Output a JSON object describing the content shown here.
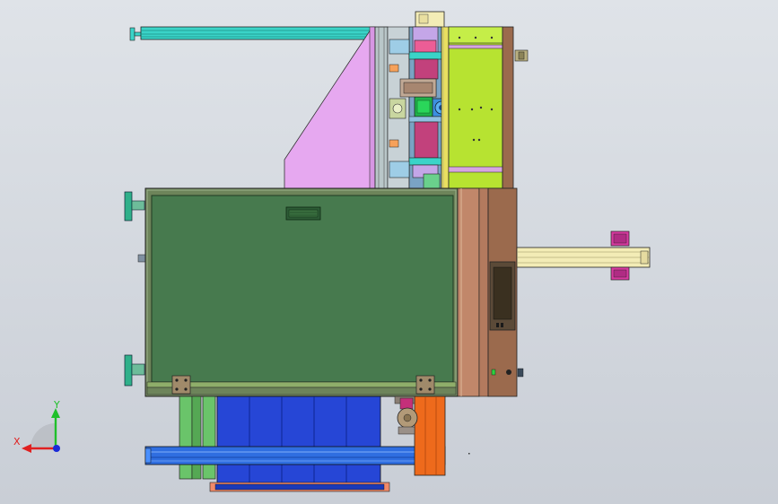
{
  "viewport": {
    "triad": {
      "x_label": "X",
      "y_label": "Y"
    }
  },
  "colors": {
    "bg_top": "#dfe3e8",
    "bg_bottom": "#c9ced6",
    "panel_green": "#477a4e",
    "frame_olive": "#6d845a",
    "pink": "#e6a8f0",
    "lime": "#b7e331",
    "brown": "#9b6a4d",
    "tan": "#c1876a",
    "blue": "#2646d6",
    "cyan": "#3ad4c8",
    "orange": "#ee6a1c",
    "magenta": "#d83aa0",
    "cream": "#f3ecb6",
    "axis_red": "#e02020",
    "axis_green": "#1fc02a",
    "axis_blue": "#1a2ad8"
  }
}
